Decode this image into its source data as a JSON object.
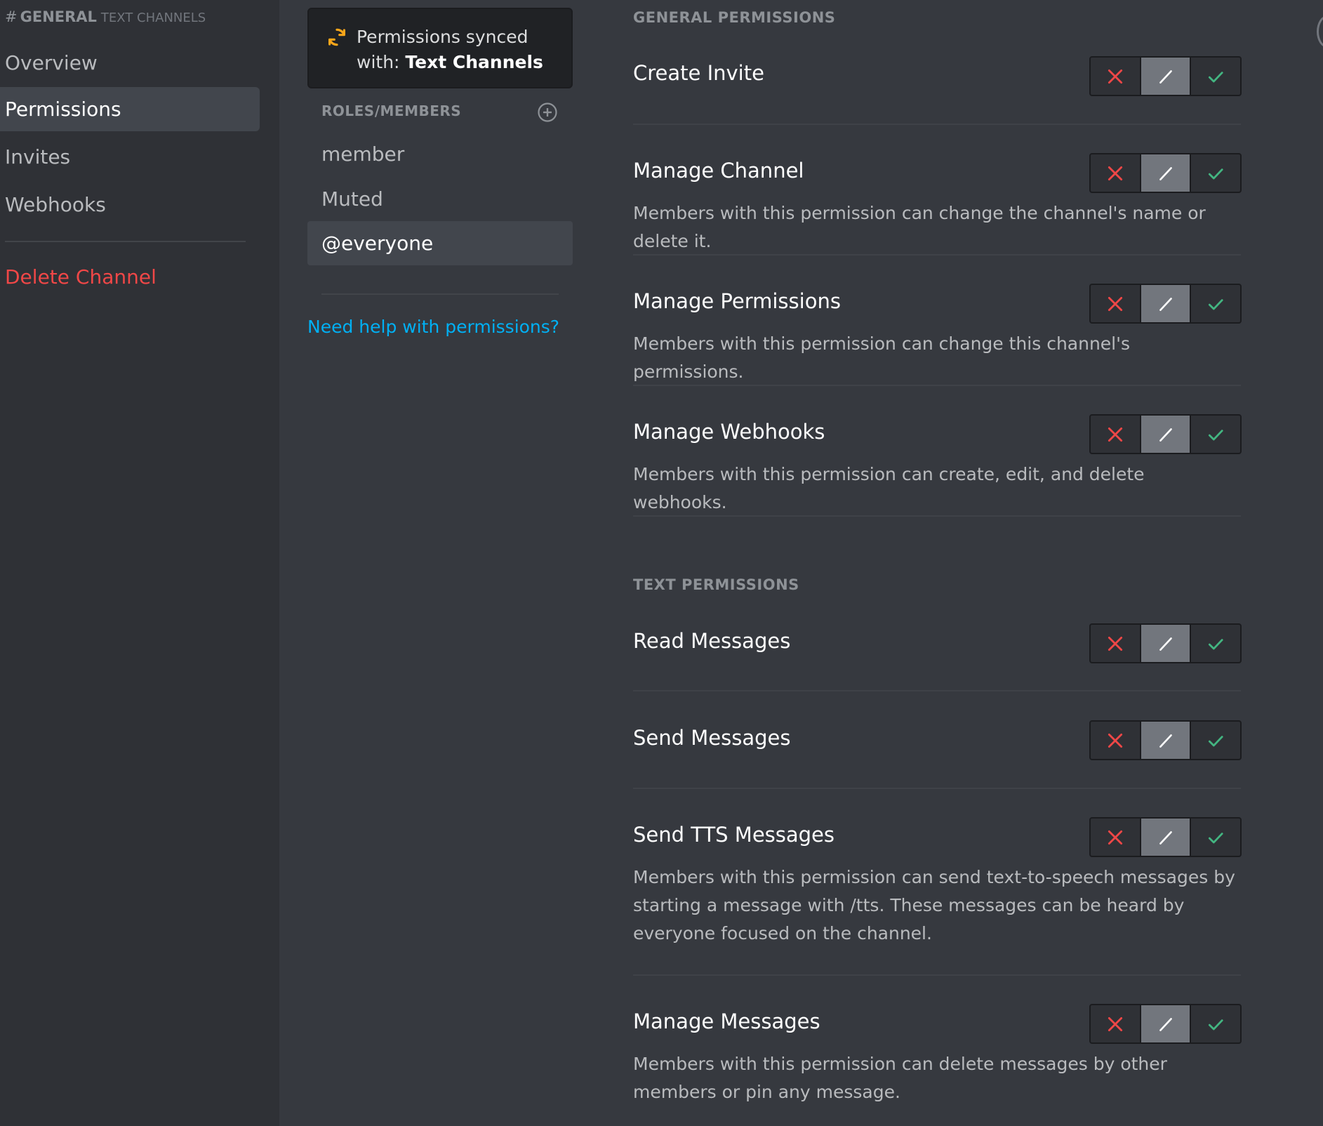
{
  "sidebar": {
    "channel_hash": "#",
    "channel_name": "GENERAL",
    "category": "TEXT CHANNELS",
    "items": [
      {
        "label": "Overview"
      },
      {
        "label": "Permissions"
      },
      {
        "label": "Invites"
      },
      {
        "label": "Webhooks"
      }
    ],
    "delete_label": "Delete Channel"
  },
  "sync": {
    "line1": "Permissions synced",
    "line2_prefix": "with: ",
    "line2_bold": "Text Channels"
  },
  "roles": {
    "header": "ROLES/MEMBERS",
    "items": [
      {
        "label": "member"
      },
      {
        "label": "Muted"
      },
      {
        "label": "@everyone"
      }
    ],
    "help_link": "Need help with permissions?"
  },
  "general": {
    "header": "GENERAL PERMISSIONS",
    "perms": [
      {
        "title": "Create Invite",
        "desc": ""
      },
      {
        "title": "Manage Channel",
        "desc": "Members with this permission can change the channel's name or delete it."
      },
      {
        "title": "Manage Permissions",
        "desc": "Members with this permission can change this channel's permissions."
      },
      {
        "title": "Manage Webhooks",
        "desc": "Members with this permission can create, edit, and delete webhooks."
      }
    ]
  },
  "text": {
    "header": "TEXT PERMISSIONS",
    "perms": [
      {
        "title": "Read Messages",
        "desc": ""
      },
      {
        "title": "Send Messages",
        "desc": ""
      },
      {
        "title": "Send TTS Messages",
        "desc": "Members with this permission can send text-to-speech messages by starting a message with /tts. These messages can be heard by everyone focused on the channel."
      },
      {
        "title": "Manage Messages",
        "desc": "Members with this permission can delete messages by other members or pin any message."
      }
    ]
  },
  "toggle_state": "neutral",
  "icons": {
    "deny": "x-icon",
    "neutral": "slash-icon",
    "allow": "check-icon",
    "sync": "sync-icon",
    "add": "plus-circle-icon"
  },
  "colors": {
    "deny": "#f04747",
    "allow": "#43b581",
    "link": "#00b0f4",
    "sync_icon": "#faa61a",
    "danger_text": "#f04747"
  }
}
